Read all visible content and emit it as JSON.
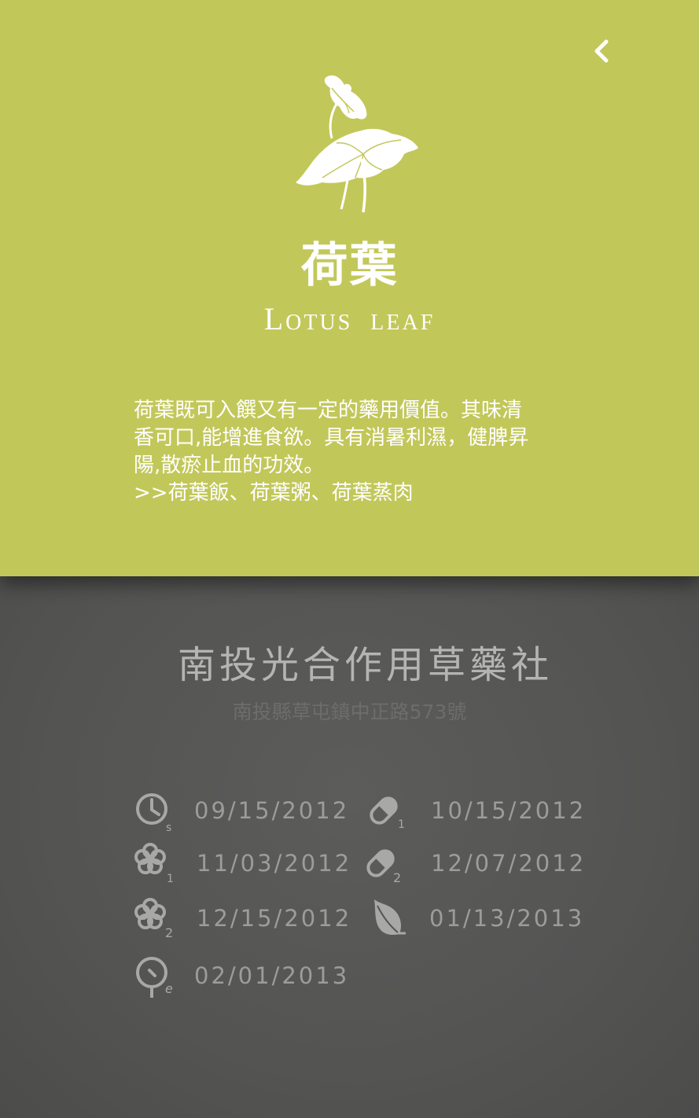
{
  "header": {
    "back_icon": "chevron-left-icon",
    "illustration_icon": "lotus-leaf-icon"
  },
  "herb": {
    "name_zh": "荷葉",
    "name_en": "Lotus leaf",
    "description_lines": [
      "荷葉既可入饌又有一定的藥用價值。其味清",
      "香可口,能增進食欲。具有消暑利濕，健脾昇",
      "陽,散瘀止血的功效。",
      ">>荷葉飯、荷葉粥、荷葉蒸肉"
    ]
  },
  "shop": {
    "name": "南投光合作用草藥社",
    "address": "南投縣草屯鎮中正路573號"
  },
  "schedule": [
    {
      "icon": "clock-start-icon",
      "sub": "s",
      "date": "09/15/2012"
    },
    {
      "icon": "capsule-icon",
      "sub": "1",
      "date": "10/15/2012"
    },
    {
      "icon": "flower-icon",
      "sub": "1",
      "date": "11/03/2012"
    },
    {
      "icon": "capsule-icon",
      "sub": "2",
      "date": "12/07/2012"
    },
    {
      "icon": "flower-icon",
      "sub": "2",
      "date": "12/15/2012"
    },
    {
      "icon": "leaf-icon",
      "sub": "",
      "date": "01/13/2013"
    },
    {
      "icon": "timer-end-icon",
      "sub": "e",
      "date": "02/01/2013"
    }
  ],
  "colors": {
    "top_background": "#c2c75a",
    "bottom_background": "#565655",
    "text_light": "#ffffff",
    "text_muted": "#9c9c9a"
  }
}
